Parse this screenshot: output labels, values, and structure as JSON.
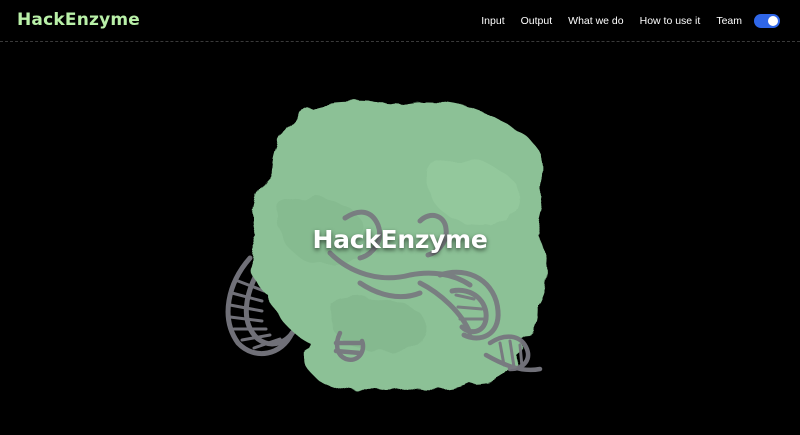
{
  "header": {
    "brand": "HackEnzyme",
    "nav": [
      {
        "label": "Input"
      },
      {
        "label": "Output"
      },
      {
        "label": "What we do"
      },
      {
        "label": "How to use it"
      },
      {
        "label": "Team"
      }
    ],
    "theme_toggle": {
      "on": true
    }
  },
  "hero": {
    "title": "HackEnzyme",
    "image": "protein-rna-complex-illustration"
  },
  "colors": {
    "background": "#000000",
    "brand": "#b9f0a8",
    "toggle": "#2f66e8",
    "protein": "#8cc196",
    "rna": "#7a7a82"
  }
}
